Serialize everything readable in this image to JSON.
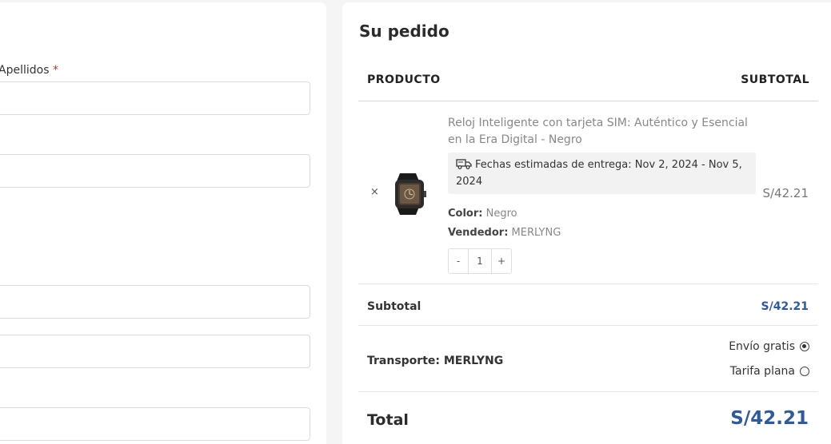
{
  "billing": {
    "apellidos_label": "Apellidos",
    "required_mark": "*"
  },
  "order": {
    "title": "Su pedido",
    "col_product": "PRODUCTO",
    "col_subtotal": "SUBTOTAL",
    "item": {
      "remove": "×",
      "name": "Reloj Inteligente con tarjeta SIM: Auténtico y Esencial en la Era Digital - Negro",
      "delivery_text": "Fechas estimadas de entrega: Nov 2, 2024 - Nov 5, 2024",
      "color_label": "Color:",
      "color_value": "Negro",
      "vendor_label": "Vendedor:",
      "vendor_value": "MERLYNG",
      "qty_minus": "-",
      "qty": "1",
      "qty_plus": "+",
      "price": "S/42.21"
    },
    "subtotal_label": "Subtotal",
    "subtotal_value": "S/42.21",
    "shipping_label": "Transporte: MERLYNG",
    "shipping_options": [
      {
        "label": "Envío gratis",
        "selected": true
      },
      {
        "label": "Tarifa plana",
        "selected": false
      }
    ],
    "total_label": "Total",
    "total_value": "S/42.21"
  },
  "colors": {
    "accent_blue": "#2f5b9a",
    "required_red": "#c0392b"
  },
  "icons": [
    "truck-icon",
    "smartwatch-thumbnail",
    "close-icon",
    "radio-selected",
    "radio-unselected"
  ]
}
